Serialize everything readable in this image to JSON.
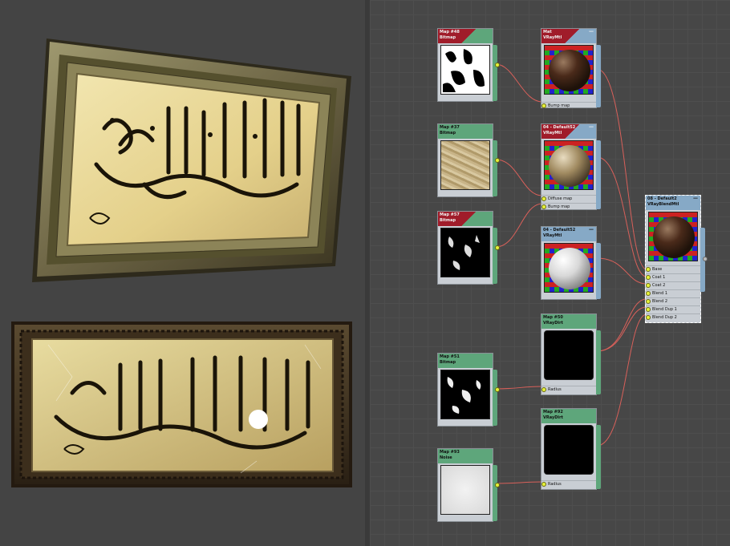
{
  "graph": {
    "nodes": [
      {
        "id": "map48",
        "line1": "Map #48",
        "line2": "Bitmap"
      },
      {
        "id": "mtl1",
        "line1": "Mat",
        "line2": "VRayMtl"
      },
      {
        "id": "map37",
        "line1": "Map #37",
        "line2": "Bitmap"
      },
      {
        "id": "mtl_default",
        "line1": "04 - Default52",
        "line2": "VRayMtl",
        "slots": [
          "Diffuse map",
          "Bump map"
        ]
      },
      {
        "id": "map57",
        "line1": "Map #57",
        "line2": "Bitmap"
      },
      {
        "id": "mtl_default2",
        "line1": "04 - Default52",
        "line2": "VRayMtl"
      },
      {
        "id": "blend",
        "line1": "08 - Default2",
        "line2": "VRayBlendMtl",
        "slots": [
          "Base",
          "Coat 1",
          "Coat 2",
          "Blend 1",
          "Blend 2",
          "Blend Dup 1",
          "Blend Dup 2"
        ]
      },
      {
        "id": "map50",
        "line1": "Map #50",
        "line2": "VRayDirt",
        "slots": [
          "Radius"
        ]
      },
      {
        "id": "map51",
        "line1": "Map #51",
        "line2": "Bitmap"
      },
      {
        "id": "map92",
        "line1": "Map #92",
        "line2": "VRayDirt",
        "slots": [
          "Radius"
        ]
      },
      {
        "id": "map93",
        "line1": "Map #93",
        "line2": "Noise"
      }
    ],
    "mtl1_slots": [
      "Bump map"
    ],
    "minimize_glyph": "—"
  },
  "colors": {
    "wire": "#d8605a",
    "node_green": "#5ea67b",
    "node_blue": "#86a9c6",
    "node_red": "#a01c2a",
    "socket": "#e6f23a"
  }
}
